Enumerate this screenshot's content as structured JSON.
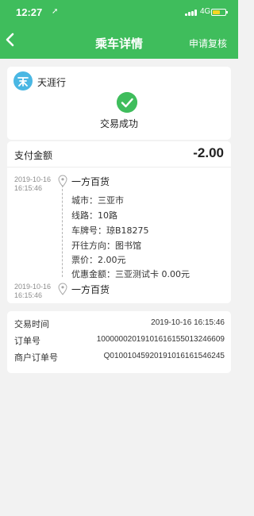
{
  "status_bar": {
    "time": "12:27",
    "network": "4G"
  },
  "nav": {
    "title": "乘车详情",
    "action": "申请复核"
  },
  "merchant": {
    "name": "天涯行"
  },
  "result": {
    "text": "交易成功"
  },
  "payment": {
    "label": "支付金额",
    "amount": "-2.00"
  },
  "trip": {
    "start_time": [
      "2019-10-16",
      "16:15:46"
    ],
    "start_stop": "一方百货",
    "details": [
      "城市：三亚市",
      "线路：10路",
      "车牌号：琼B18275",
      "开往方向：图书馆",
      "票价：2.00元",
      "优惠金额：三亚测试卡 0.00元"
    ],
    "end_time": [
      "2019-10-16",
      "16:15:46"
    ],
    "end_stop": "一方百货"
  },
  "info": [
    {
      "label": "交易时间",
      "value": "2019-10-16 16:15:46"
    },
    {
      "label": "订单号",
      "value": "10000002019101616155013246609"
    },
    {
      "label": "商户订单号",
      "value": "Q010010459201910161615462​45"
    }
  ],
  "colors": {
    "primary": "#3fbd5c",
    "background": "#f2f2f2"
  }
}
